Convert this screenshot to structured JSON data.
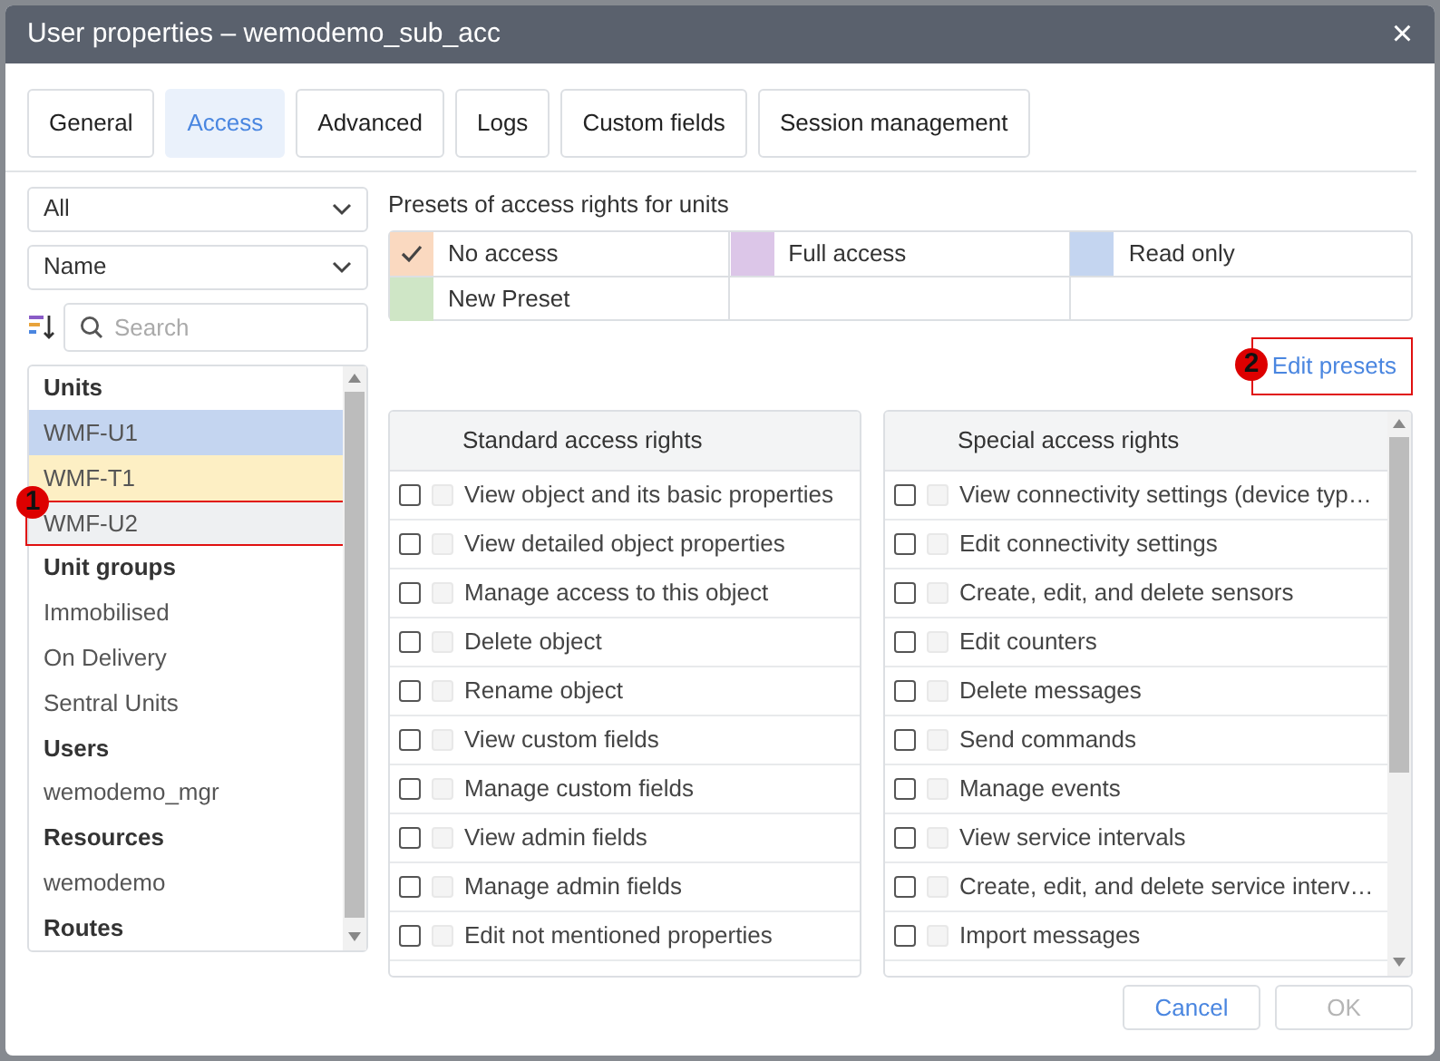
{
  "window": {
    "title": "User properties – wemodemo_sub_acc",
    "close": "×"
  },
  "tabs": [
    {
      "label": "General",
      "selected": false
    },
    {
      "label": "Access",
      "selected": true
    },
    {
      "label": "Advanced",
      "selected": false
    },
    {
      "label": "Logs",
      "selected": false
    },
    {
      "label": "Custom fields",
      "selected": false
    },
    {
      "label": "Session management",
      "selected": false
    }
  ],
  "filters": [
    {
      "value": "All"
    },
    {
      "value": "Name"
    }
  ],
  "search": {
    "placeholder": "Search"
  },
  "objects": [
    {
      "kind": "header",
      "label": "Units"
    },
    {
      "kind": "item",
      "label": "WMF-U1",
      "color": "#c4d5f0"
    },
    {
      "kind": "item",
      "label": "WMF-T1",
      "color": "#fdefc4"
    },
    {
      "kind": "item",
      "label": "WMF-U2",
      "color": "#eef0f2",
      "annotation": "1",
      "annotated": true
    },
    {
      "kind": "header",
      "label": "Unit groups"
    },
    {
      "kind": "item",
      "label": "Immobilised"
    },
    {
      "kind": "item",
      "label": "On Delivery"
    },
    {
      "kind": "item",
      "label": "Sentral Units"
    },
    {
      "kind": "header",
      "label": "Users"
    },
    {
      "kind": "item",
      "label": "wemodemo_mgr"
    },
    {
      "kind": "header",
      "label": "Resources"
    },
    {
      "kind": "item",
      "label": "wemodemo"
    },
    {
      "kind": "header",
      "label": "Routes"
    }
  ],
  "presets": {
    "title": "Presets of access rights for units",
    "items": [
      {
        "label": "No access",
        "color": "#fad9c0",
        "checked": true
      },
      {
        "label": "Full access",
        "color": "#dcc6e8",
        "checked": false
      },
      {
        "label": "Read only",
        "color": "#c4d5f0",
        "checked": false
      },
      {
        "label": "New Preset",
        "color": "#cfe6c6",
        "checked": false
      }
    ],
    "edit_link": {
      "label": "Edit presets",
      "annotation": "2"
    }
  },
  "rights": [
    {
      "title": "Standard access rights",
      "items": [
        {
          "label": "View object and its basic properties",
          "checked": false,
          "allowed": false
        },
        {
          "label": "View detailed object properties",
          "checked": false,
          "allowed": false
        },
        {
          "label": "Manage access to this object",
          "checked": false,
          "allowed": false
        },
        {
          "label": "Delete object",
          "checked": false,
          "allowed": false
        },
        {
          "label": "Rename object",
          "checked": false,
          "allowed": false
        },
        {
          "label": "View custom fields",
          "checked": false,
          "allowed": false
        },
        {
          "label": "Manage custom fields",
          "checked": false,
          "allowed": false
        },
        {
          "label": "View admin fields",
          "checked": false,
          "allowed": false
        },
        {
          "label": "Manage admin fields",
          "checked": false,
          "allowed": false
        },
        {
          "label": "Edit not mentioned properties",
          "checked": false,
          "allowed": false
        }
      ]
    },
    {
      "title": "Special access rights",
      "items": [
        {
          "label": "View connectivity settings (device typ…",
          "checked": false,
          "allowed": false
        },
        {
          "label": "Edit connectivity settings",
          "checked": false,
          "allowed": false
        },
        {
          "label": "Create, edit, and delete sensors",
          "checked": false,
          "allowed": false
        },
        {
          "label": "Edit counters",
          "checked": false,
          "allowed": false
        },
        {
          "label": "Delete messages",
          "checked": false,
          "allowed": false
        },
        {
          "label": "Send commands",
          "checked": false,
          "allowed": false
        },
        {
          "label": "Manage events",
          "checked": false,
          "allowed": false
        },
        {
          "label": "View service intervals",
          "checked": false,
          "allowed": false
        },
        {
          "label": "Create, edit, and delete service interv…",
          "checked": false,
          "allowed": false
        },
        {
          "label": "Import messages",
          "checked": false,
          "allowed": false
        }
      ]
    }
  ],
  "buttons": [
    {
      "label": "Cancel",
      "disabled": false
    },
    {
      "label": "OK",
      "disabled": true
    }
  ]
}
